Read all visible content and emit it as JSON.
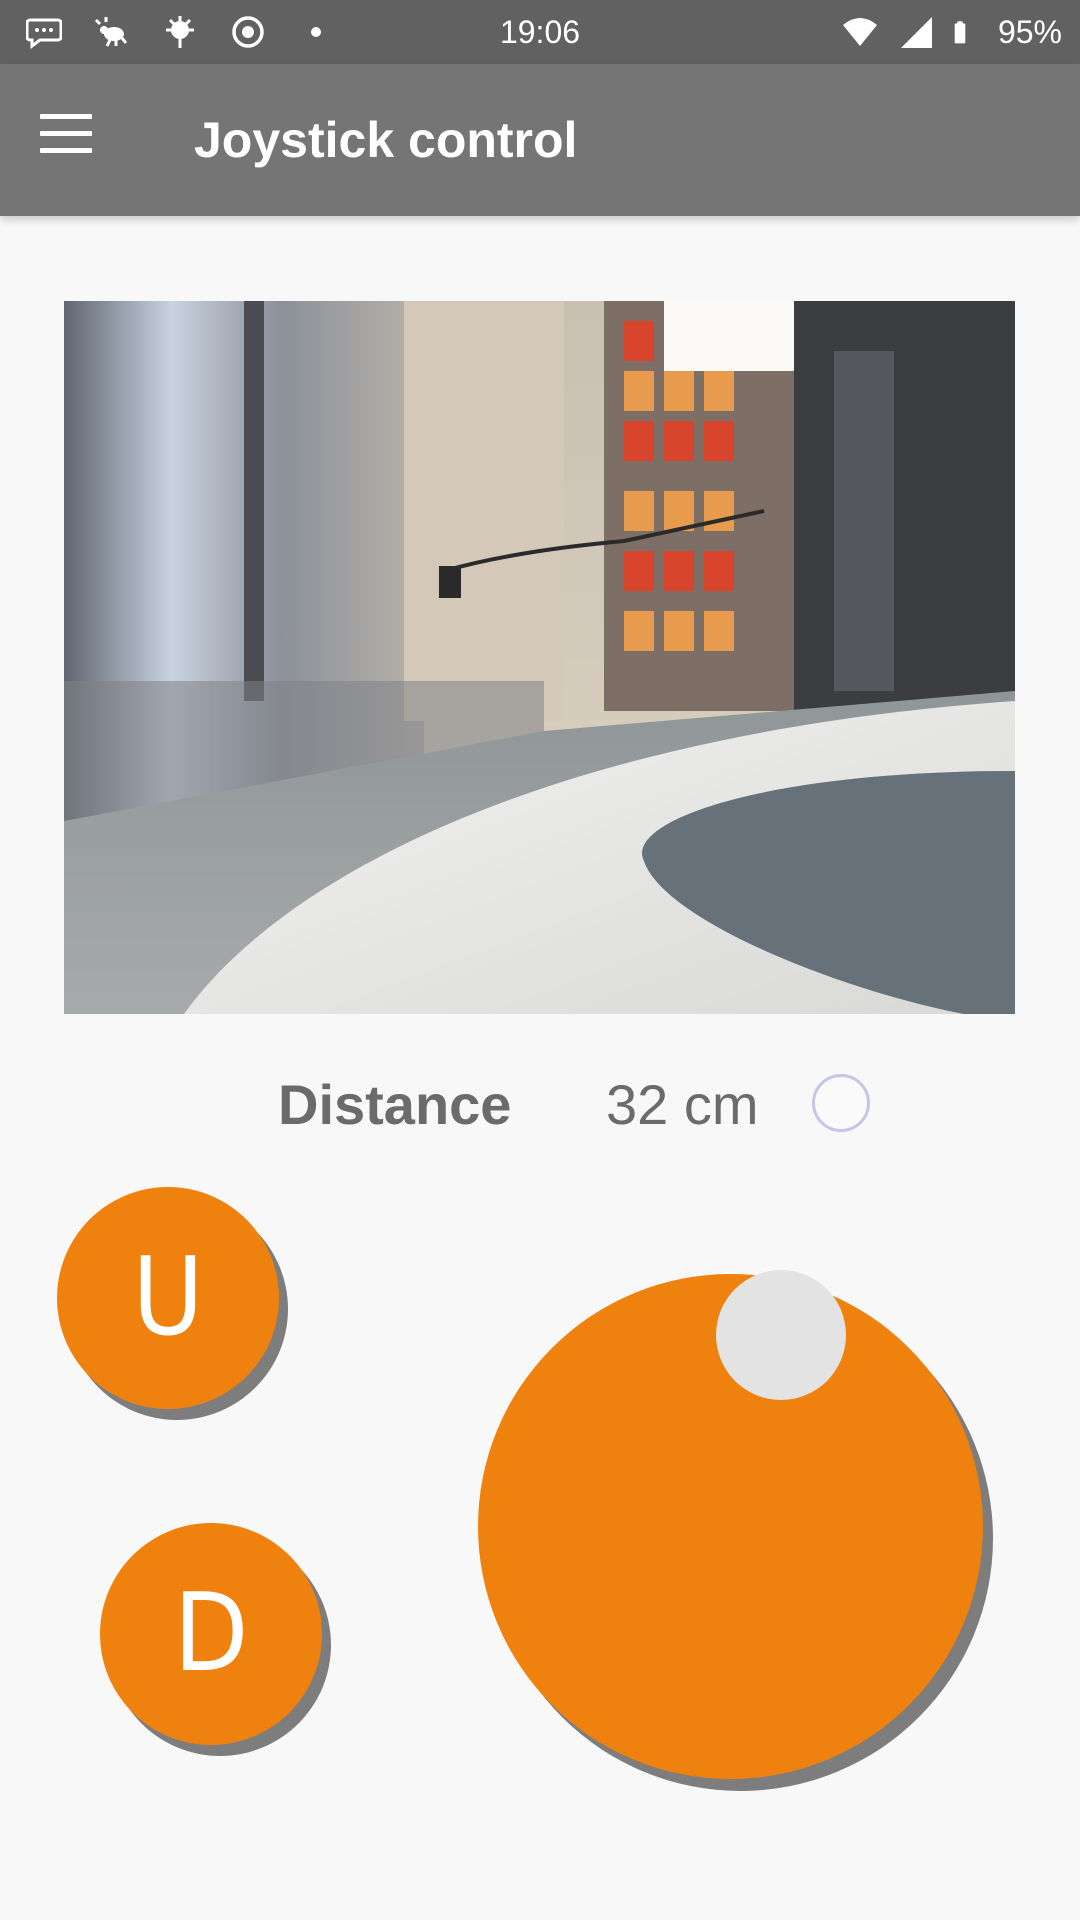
{
  "status_bar": {
    "time": "19:06",
    "battery": "95%",
    "icons": [
      "messaging-icon",
      "bug-icon",
      "virus-icon",
      "target-icon",
      "dot-icon",
      "wifi-icon",
      "signal-icon",
      "battery-icon"
    ]
  },
  "toolbar": {
    "title": "Joystick control",
    "menu_icon": "hamburger-menu-icon"
  },
  "camera": {
    "description_icon": "camera-feed"
  },
  "distance": {
    "label": "Distance",
    "value": "32 cm",
    "indicator_selected": false
  },
  "controls": {
    "up_label": "U",
    "down_label": "D",
    "joystick_knob_position": {
      "x": 0.1,
      "y": -0.75
    }
  },
  "colors": {
    "status_bar": "#616161",
    "toolbar": "#757575",
    "accent": "#ef820f",
    "knob": "#e3e3e3",
    "shadow": "#7d7d7d",
    "text_secondary": "#6b6b6b"
  }
}
